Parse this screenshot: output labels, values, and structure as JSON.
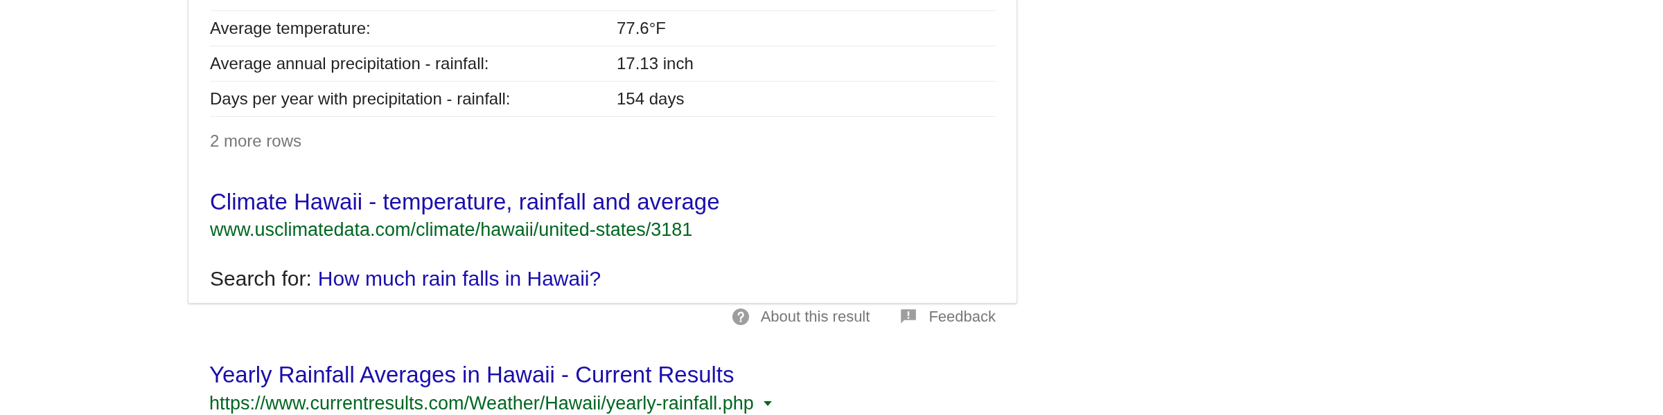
{
  "answer_table": {
    "rows": [
      {
        "label": "Average temperature:",
        "value": "77.6°F"
      },
      {
        "label": "Average annual precipitation - rainfall:",
        "value": "17.13 inch"
      },
      {
        "label": "Days per year with precipitation - rainfall:",
        "value": "154 days"
      }
    ],
    "more_rows": "2 more rows"
  },
  "source": {
    "title": "Climate Hawaii - temperature, rainfall and average",
    "url": "www.usclimatedata.com/climate/hawaii/united-states/3181"
  },
  "search_for": {
    "label": "Search for:",
    "query": "How much rain falls in Hawaii?"
  },
  "footer_links": [
    {
      "kind": "about",
      "label": "About this result"
    },
    {
      "kind": "feedback",
      "label": "Feedback"
    }
  ],
  "results": [
    {
      "title": "Yearly Rainfall Averages in Hawaii - Current Results",
      "url": "https://www.currentresults.com/Weather/Hawaii/yearly-rainfall.php",
      "menu_caret": true
    }
  ]
}
